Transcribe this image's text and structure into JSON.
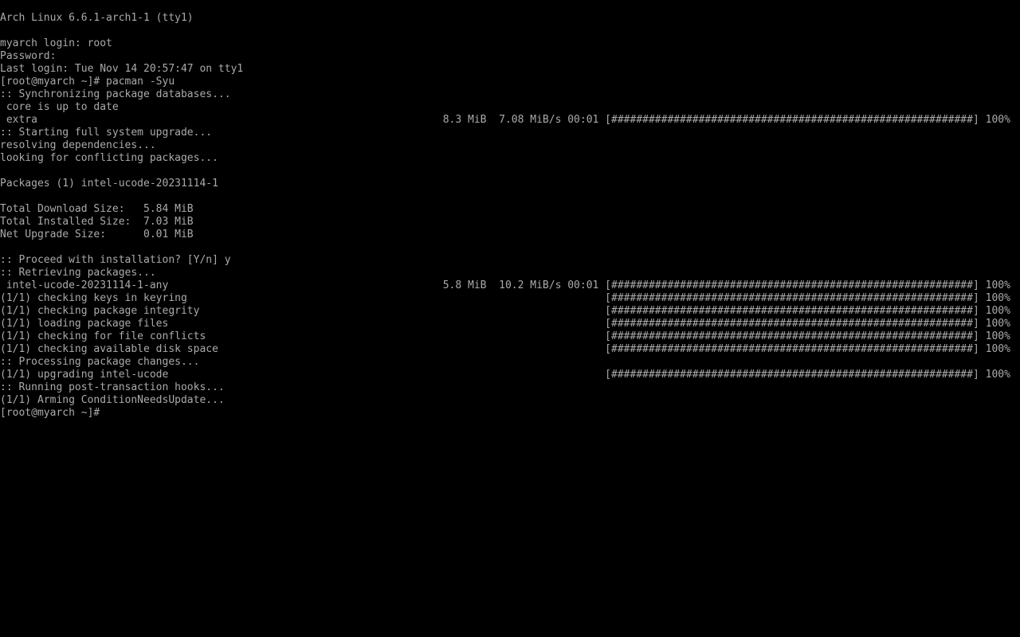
{
  "terminal": {
    "tty": "tty1",
    "lines": [
      "Arch Linux 6.6.1-arch1-1 (tty1)",
      "",
      "myarch login: root",
      "Password:",
      "Last login: Tue Nov 14 20:57:47 on tty1",
      "[root@myarch ~]# pacman -Syu",
      ":: Synchronizing package databases...",
      " core is up to date",
      " extra                                                                 8.3 MiB  7.08 MiB/s 00:01 [##########################################################] 100%",
      ":: Starting full system upgrade...",
      "resolving dependencies...",
      "looking for conflicting packages...",
      "",
      "Packages (1) intel-ucode-20231114-1",
      "",
      "Total Download Size:   5.84 MiB",
      "Total Installed Size:  7.03 MiB",
      "Net Upgrade Size:      0.01 MiB",
      "",
      ":: Proceed with installation? [Y/n] y",
      ":: Retrieving packages...",
      " intel-ucode-20231114-1-any                                            5.8 MiB  10.2 MiB/s 00:01 [##########################################################] 100%",
      "(1/1) checking keys in keyring                                                                   [##########################################################] 100%",
      "(1/1) checking package integrity                                                                 [##########################################################] 100%",
      "(1/1) loading package files                                                                      [##########################################################] 100%",
      "(1/1) checking for file conflicts                                                                [##########################################################] 100%",
      "(1/1) checking available disk space                                                              [##########################################################] 100%",
      ":: Processing package changes...",
      "(1/1) upgrading intel-ucode                                                                      [##########################################################] 100%",
      ":: Running post-transaction hooks...",
      "(1/1) Arming ConditionNeedsUpdate...",
      "[root@myarch ~]#"
    ]
  },
  "colors": {
    "background": "#000000",
    "foreground": "#aaaaaa"
  }
}
